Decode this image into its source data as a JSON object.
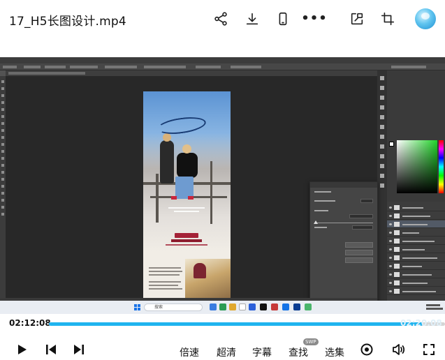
{
  "topbar": {
    "title": "17_H5长图设计.mp4",
    "icons": [
      "share-icon",
      "download-icon",
      "phone-icon",
      "more-icon",
      "picture-in-picture-icon",
      "crop-icon",
      "avatar"
    ]
  },
  "screen": {
    "taskbar": {
      "search_text": "搜索"
    }
  },
  "player": {
    "current_time": "02:12:08",
    "duration": "02:20:08",
    "progress": 0.943,
    "accent_color": "#1fb4ef",
    "controls": {
      "speed": "倍速",
      "quality": "超清",
      "subtitle": "字幕",
      "search": "查找",
      "search_badge": "SWP",
      "episodes": "选集"
    }
  }
}
